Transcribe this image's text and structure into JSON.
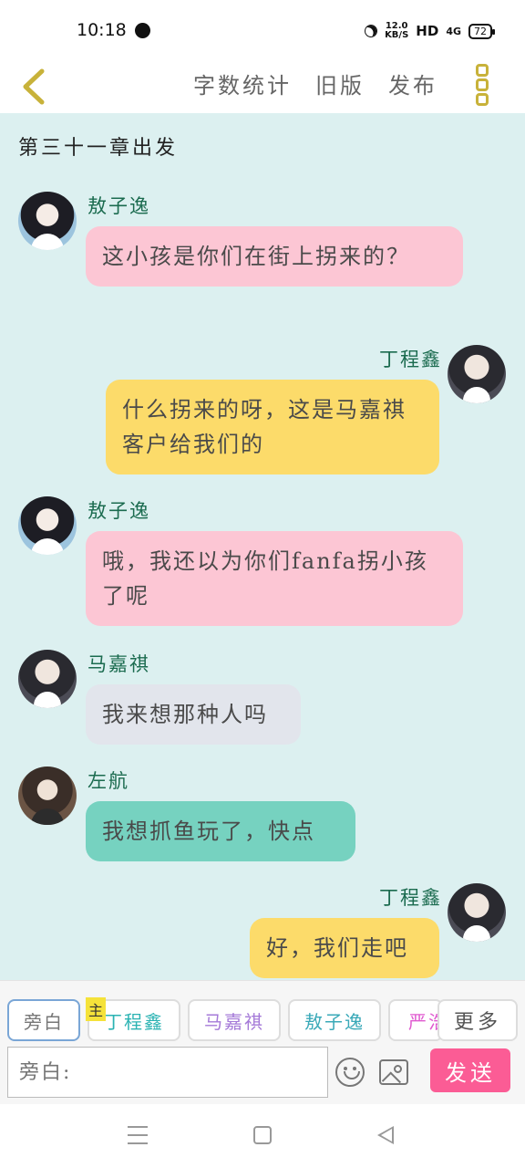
{
  "status_bar": {
    "time": "10:18",
    "speed_value": "12.0",
    "speed_unit": "KB/S",
    "hd": "HD",
    "signal": "4G",
    "battery": "72"
  },
  "nav": {
    "word_count": "字数统计",
    "old_version": "旧版",
    "publish": "发布"
  },
  "chapter_title": "第三十一章出发",
  "messages": [
    {
      "sender": "敖子逸",
      "text": "这小孩是你们在街上拐来的？",
      "side": "left",
      "color": "pink"
    },
    {
      "sender": "丁程鑫",
      "text": "什么拐来的呀，这是马嘉祺客户给我们的",
      "side": "right",
      "color": "yellow"
    },
    {
      "sender": "敖子逸",
      "text": "哦，我还以为你们fanfa拐小孩了呢",
      "side": "left",
      "color": "pink"
    },
    {
      "sender": "马嘉祺",
      "text": "我来想那种人吗",
      "side": "left",
      "color": "gray"
    },
    {
      "sender": "左航",
      "text": "我想抓鱼玩了，快点",
      "side": "left",
      "color": "teal"
    },
    {
      "sender": "丁程鑫",
      "text": "好，我们走吧",
      "side": "right",
      "color": "yellow"
    }
  ],
  "composer": {
    "tabs": [
      {
        "label": "旁白",
        "color": "#777777"
      },
      {
        "label": "丁程鑫",
        "color": "#2bb3b3"
      },
      {
        "label": "马嘉祺",
        "color": "#a57ad8"
      },
      {
        "label": "敖子逸",
        "color": "#3aa9b8"
      },
      {
        "label": "严浩翔",
        "color": "#e05ad0"
      }
    ],
    "main_badge": "主",
    "more_label": "更多",
    "input_placeholder": "旁白:",
    "send_label": "发送"
  }
}
